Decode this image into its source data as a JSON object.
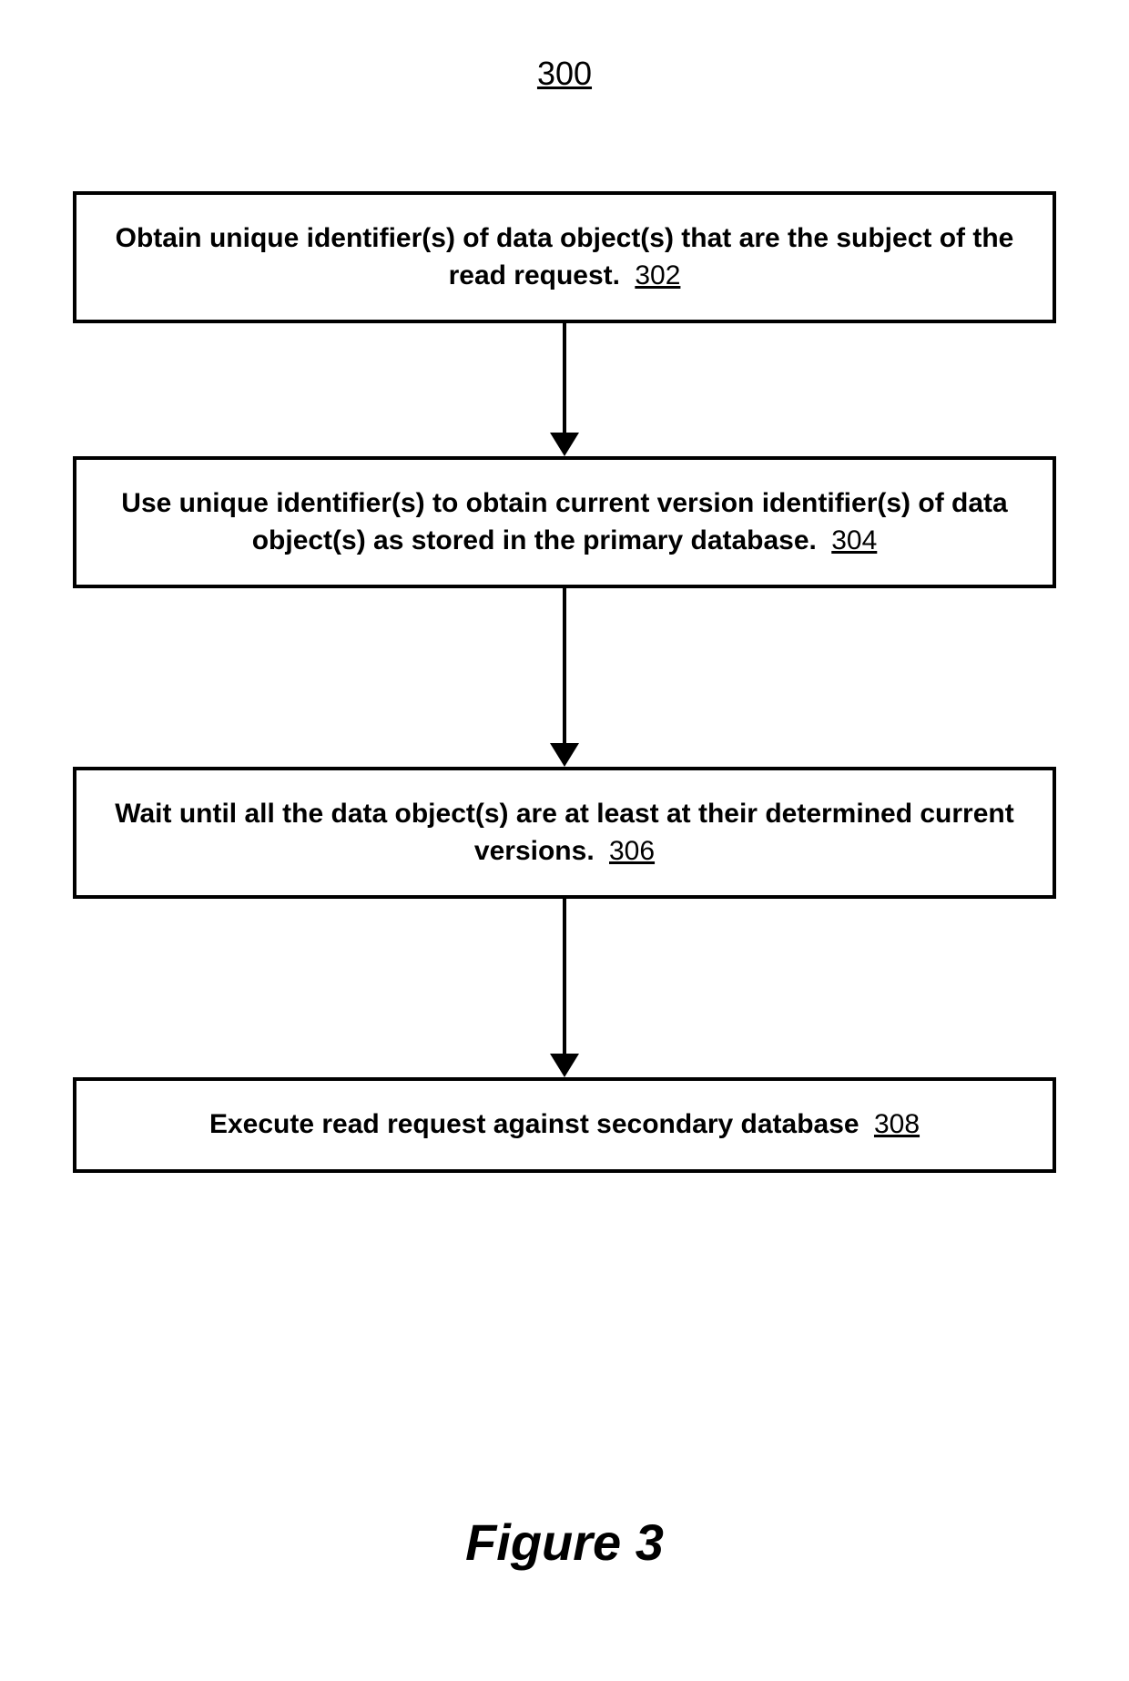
{
  "figure_number": "300",
  "caption": "Figure 3",
  "steps": [
    {
      "text": "Obtain unique identifier(s) of data object(s) that are the subject of the read request.",
      "ref": "302"
    },
    {
      "text": "Use unique identifier(s) to obtain current version identifier(s) of data object(s) as stored in the primary database.",
      "ref": "304"
    },
    {
      "text": "Wait until all the data object(s) are at least at their determined current versions.",
      "ref": "306"
    },
    {
      "text": "Execute read request against secondary database",
      "ref": "308"
    }
  ],
  "arrow_heights": [
    120,
    170,
    170
  ]
}
